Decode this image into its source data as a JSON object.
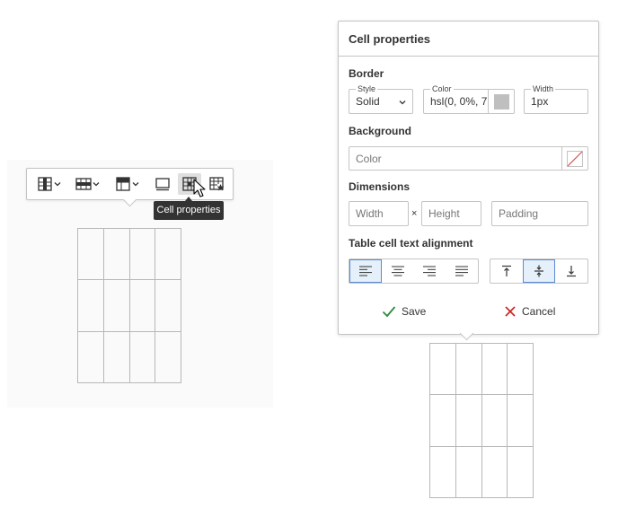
{
  "toolbar": {
    "buttons": [
      {
        "name": "table-column-icon",
        "has_dropdown": true
      },
      {
        "name": "table-row-icon",
        "has_dropdown": true
      },
      {
        "name": "table-merge-cells-icon",
        "has_dropdown": true
      },
      {
        "name": "table-properties-icon",
        "has_dropdown": false
      },
      {
        "name": "table-cell-properties-icon",
        "has_dropdown": false
      },
      {
        "name": "table-cell-star-icon",
        "has_dropdown": false
      }
    ],
    "tooltip": "Cell properties"
  },
  "panel": {
    "title": "Cell properties",
    "border": {
      "label": "Border",
      "style_label": "Style",
      "style_value": "Solid",
      "color_label": "Color",
      "color_value": "hsl(0, 0%, 7",
      "width_label": "Width",
      "width_value": "1px"
    },
    "background": {
      "label": "Background",
      "color_placeholder": "Color"
    },
    "dimensions": {
      "label": "Dimensions",
      "width_placeholder": "Width",
      "times": "×",
      "height_placeholder": "Height",
      "padding_placeholder": "Padding"
    },
    "alignment": {
      "label": "Table cell text alignment",
      "horizontal": [
        "align-left-icon",
        "align-center-icon",
        "align-right-icon",
        "align-justify-icon"
      ],
      "vertical": [
        "align-top-icon",
        "align-middle-icon",
        "align-bottom-icon"
      ],
      "selected_horizontal": "align-left-icon",
      "selected_vertical": "align-middle-icon"
    },
    "save_label": "Save",
    "cancel_label": "Cancel"
  },
  "colors": {
    "border": "#c4c4c4",
    "selected_bg": "#e6f0fa",
    "selected_outline": "#5b8bd6",
    "save_check": "#2e8b3a",
    "cancel_x": "#cc2222",
    "swatch_gray": "#bfbfbf"
  }
}
